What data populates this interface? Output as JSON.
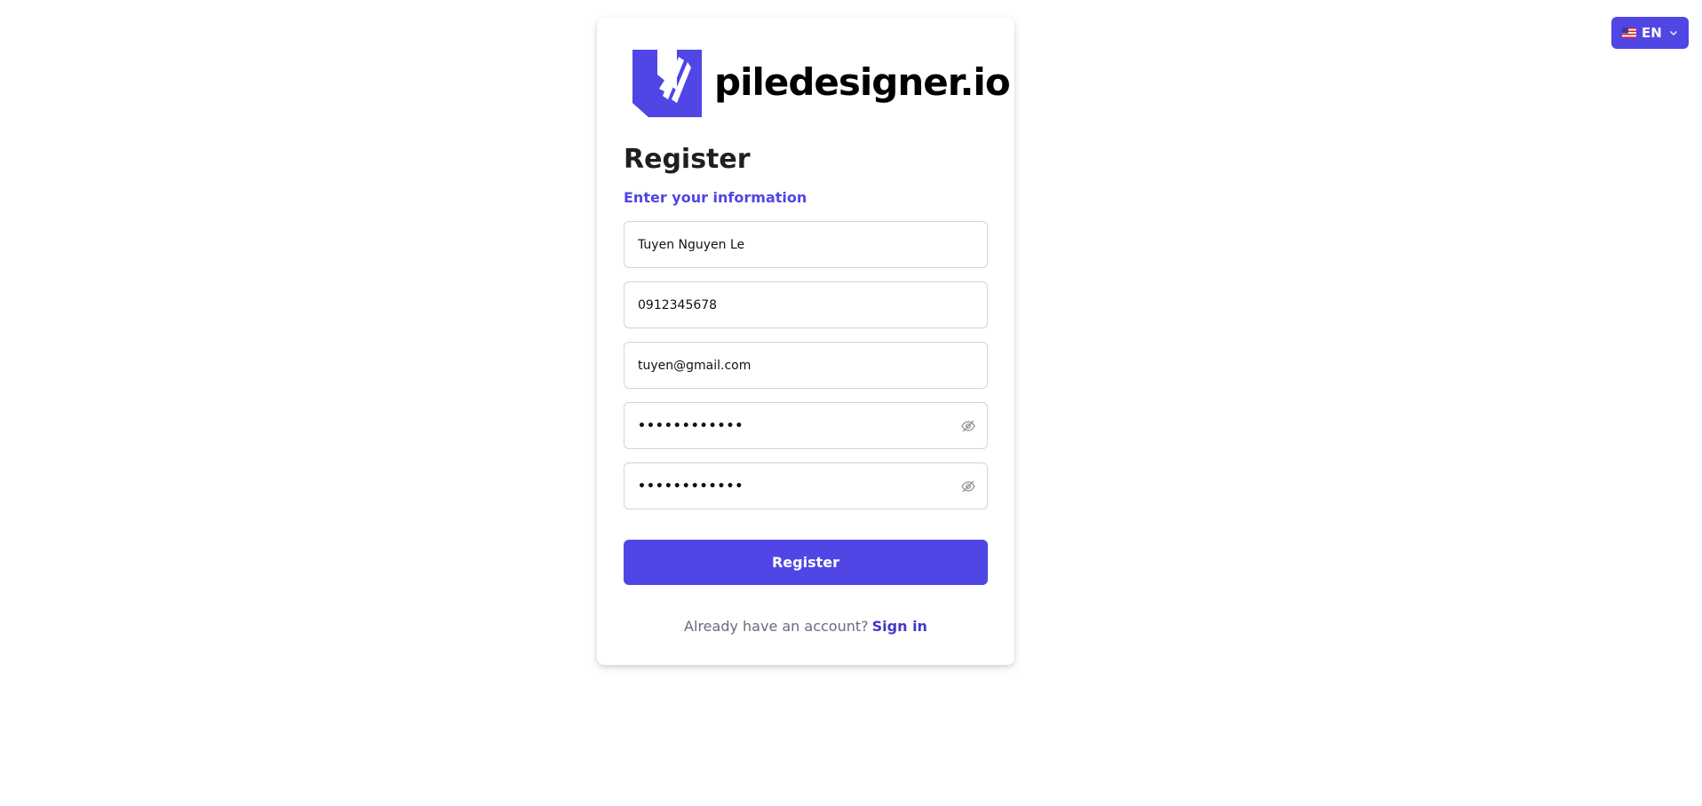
{
  "language": {
    "code": "EN",
    "flag_icon": "us-flag-icon",
    "dropdown_icon": "chevron-down-icon"
  },
  "brand": {
    "name": "piledesigner.io",
    "color": "#4f46e5"
  },
  "form": {
    "title": "Register",
    "subtitle": "Enter your information",
    "fields": {
      "full_name": "Tuyen Nguyen Le",
      "phone": "0912345678",
      "email": "tuyen@gmail.com",
      "password_mask": "••••••••••••",
      "confirm_password_mask": "••••••••••••"
    },
    "submit_label": "Register",
    "footer_text": "Already have an account?",
    "sign_in_label": "Sign in"
  }
}
